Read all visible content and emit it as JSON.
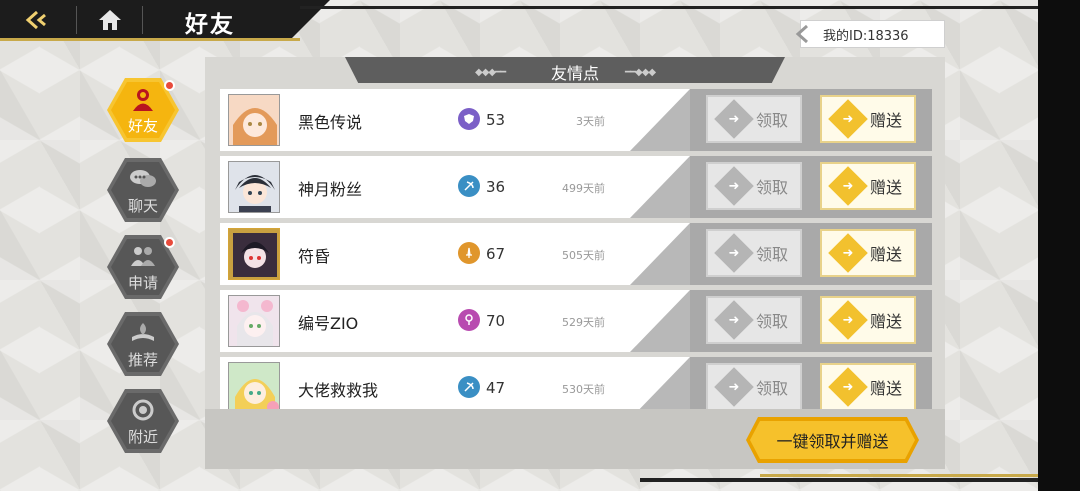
{
  "header": {
    "title": "好友",
    "my_id": "我的ID:18336"
  },
  "nav": [
    {
      "label": "好友",
      "icon": "friends-icon",
      "active": true,
      "badge": true
    },
    {
      "label": "聊天",
      "icon": "chat-icon",
      "active": false,
      "badge": false
    },
    {
      "label": "申请",
      "icon": "request-icon",
      "active": false,
      "badge": true
    },
    {
      "label": "推荐",
      "icon": "recommend-icon",
      "active": false,
      "badge": false
    },
    {
      "label": "附近",
      "icon": "nearby-icon",
      "active": false,
      "badge": false
    }
  ],
  "panel": {
    "title": "友情点"
  },
  "friends": [
    {
      "name": "黑色传说",
      "level": "53",
      "time": "3天前",
      "class_color": "#7b5fc7",
      "class_icon": "shield-class-icon",
      "avatar_color": "#f2b58a"
    },
    {
      "name": "神月粉丝",
      "level": "36",
      "time": "499天前",
      "class_color": "#3a8fc4",
      "class_icon": "bow-class-icon",
      "avatar_color": "#5a6070"
    },
    {
      "name": "符昏",
      "level": "67",
      "time": "505天前",
      "class_color": "#e0962c",
      "class_icon": "sword-class-icon",
      "avatar_color": "#3b3040"
    },
    {
      "name": "编号ZIO",
      "level": "70",
      "time": "529天前",
      "class_color": "#b84bb0",
      "class_icon": "staff-class-icon",
      "avatar_color": "#e9d9e6"
    },
    {
      "name": "大佬救救我",
      "level": "47",
      "time": "530天前",
      "class_color": "#3a8fc4",
      "class_icon": "bow-class-icon",
      "avatar_color": "#f1d27a"
    }
  ],
  "buttons": {
    "claim": "领取",
    "gift": "赠送",
    "claim_all": "一键领取并赠送"
  },
  "colors": {
    "accent": "#f6c12b",
    "badge": "#e84b3c"
  }
}
